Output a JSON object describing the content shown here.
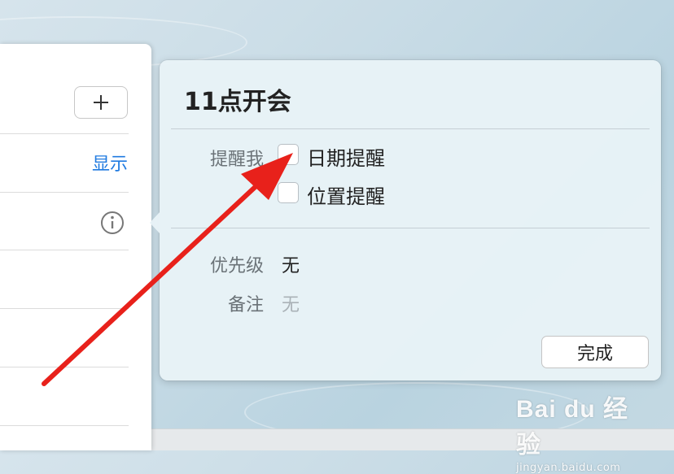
{
  "left_panel": {
    "show_link": "显示"
  },
  "popover": {
    "title": "11点开会",
    "remind_label": "提醒我",
    "date_reminder_label": "日期提醒",
    "location_reminder_label": "位置提醒",
    "priority_label": "优先级",
    "priority_value": "无",
    "notes_label": "备注",
    "notes_placeholder": "无",
    "done_label": "完成"
  },
  "watermark": {
    "logo": "Bai du 经验",
    "url": "jingyan.baidu.com"
  },
  "colors": {
    "accent": "#1f7ae0",
    "annotation_arrow": "#e8211b"
  },
  "icons": [
    "plus-icon",
    "info-icon"
  ]
}
